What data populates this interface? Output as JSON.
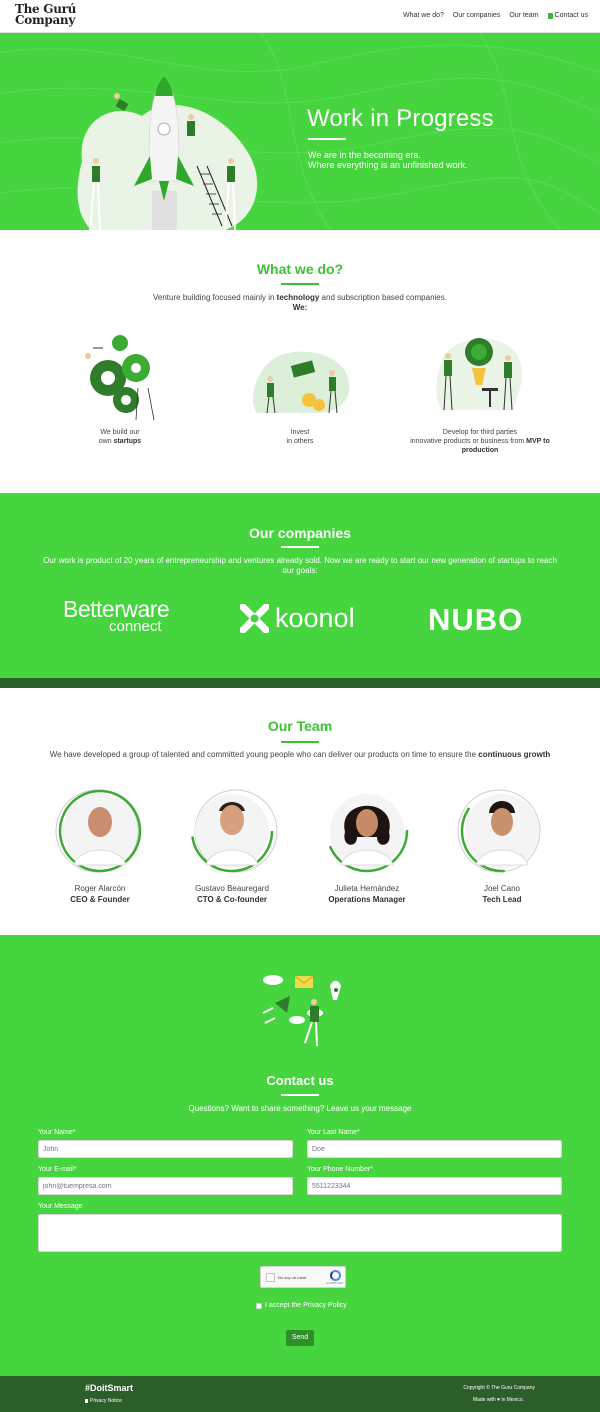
{
  "nav": {
    "logo_line1": "The Gurú",
    "logo_line2": "Company",
    "items": [
      "What we do?",
      "Our companies",
      "Our team"
    ],
    "contact": "Contact us"
  },
  "hero": {
    "title": "Work in Progress",
    "line1": "We are in the becoming era.",
    "line2": "Where everything is an unfinished work."
  },
  "what_we_do": {
    "title": "What we do?",
    "intro_pre": "Venture building focused mainly in ",
    "intro_bold": "technology",
    "intro_post": " and subscription based companies.",
    "we": "We:",
    "features": [
      {
        "line1": "We build our",
        "line2_pre": "own ",
        "line2_bold": "startups"
      },
      {
        "line1": "Invest",
        "line2_pre": "in others",
        "line2_bold": ""
      },
      {
        "line1": "Develop for third parties",
        "line2_pre": "innovative products or business from ",
        "line2_bold": "MVP to production"
      }
    ]
  },
  "companies": {
    "title": "Our companies",
    "text": "Our work is product of 20 years of entrepreneurship and ventures already sold. Now we are ready to start our new generation of startups to reach our goals:",
    "brands": [
      {
        "name": "Betterware",
        "sub": "connect"
      },
      {
        "name": "koonol"
      },
      {
        "name": "NUBO"
      }
    ]
  },
  "team": {
    "title": "Our Team",
    "text_pre": "We have developed a group of talented and committed young people who can deliver our products on time to ensure the ",
    "text_bold": "continuous growth",
    "members": [
      {
        "name": "Roger Alarcón",
        "role": "CEO & Founder"
      },
      {
        "name": "Gustavo Beauregard",
        "role": "CTO & Co-founder"
      },
      {
        "name": "Julieta Hernández",
        "role": "Operations Manager"
      },
      {
        "name": "Joel Cano",
        "role": "Tech Lead"
      }
    ]
  },
  "contact": {
    "title": "Contact us",
    "text": "Questions? Want to share something? Leave us your message",
    "fields": {
      "name_label": "Your Name*",
      "name_ph": "John",
      "last_label": "Your Last Name*",
      "last_ph": "Doe",
      "email_label": "Your E-mail*",
      "email_ph": "john@tuempresa.com",
      "phone_label": "Your Phone Number*",
      "phone_ph": "5511223344",
      "message_label": "Your Message"
    },
    "captcha_text": "No soy un robot",
    "captcha_brand": "reCAPTCHA",
    "privacy": "I accept the Privacy Policy",
    "send": "Send"
  },
  "footer": {
    "tag": "#DoitSmart",
    "privacy": "Privacy Notice",
    "copyright": "Copyright © The Guru Company",
    "made_pre": "Made with",
    "made_post": "in Mexico."
  },
  "colors": {
    "green": "#47d53f",
    "dark_green": "#2c5e29",
    "heading_green": "#3bc234"
  }
}
